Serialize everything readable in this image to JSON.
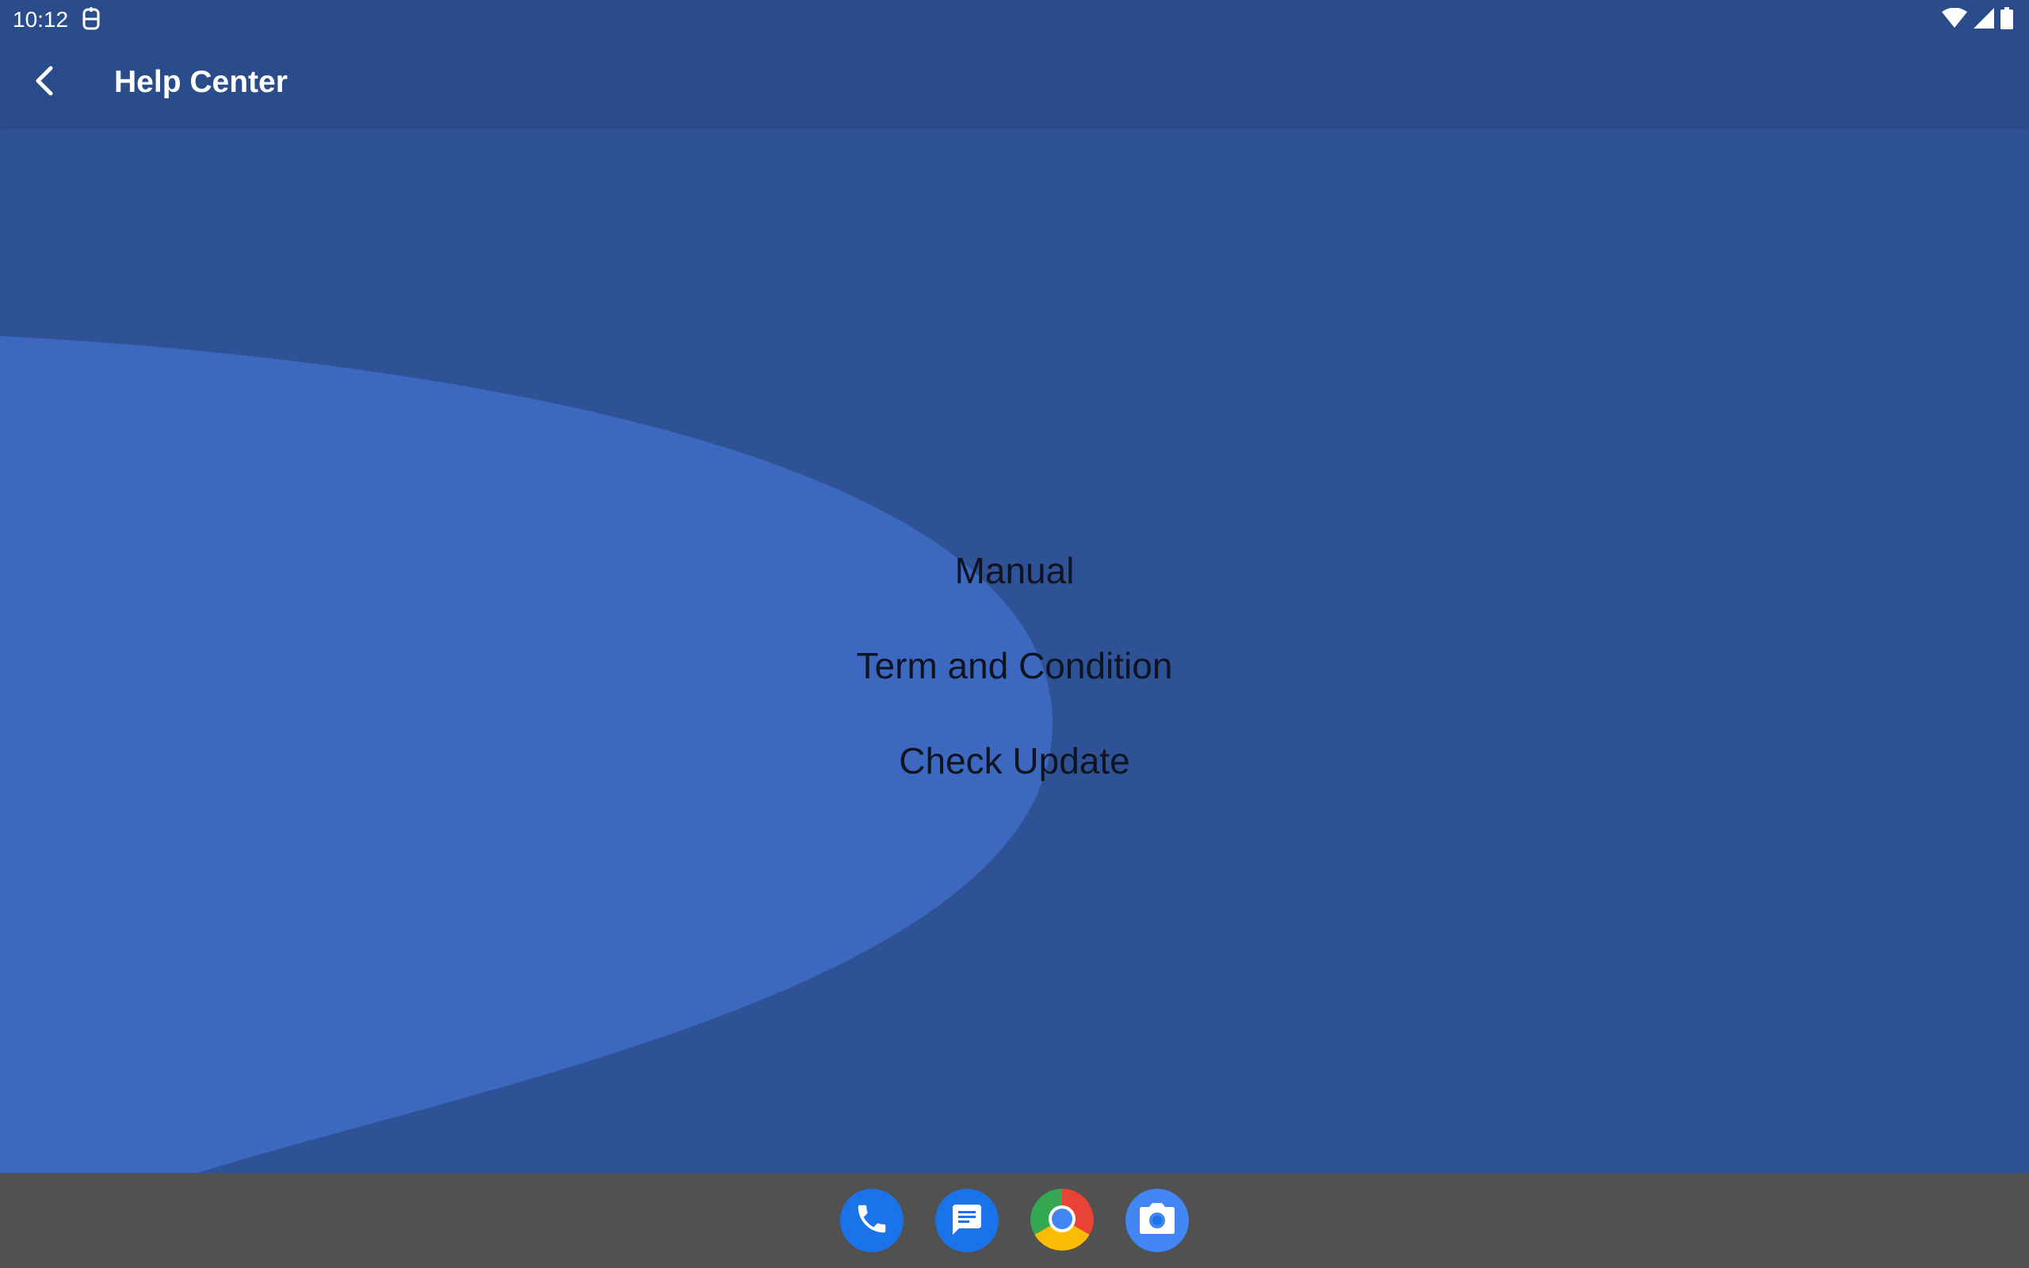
{
  "status_bar": {
    "time": "10:12",
    "notification_icon": "vpn-key-icon",
    "right_icons": [
      "wifi-icon",
      "cell-signal-icon",
      "battery-icon"
    ]
  },
  "app_bar": {
    "back_icon": "chevron-left-icon",
    "title": "Help Center"
  },
  "menu": {
    "items": [
      {
        "label": "Manual"
      },
      {
        "label": "Term and Condition"
      },
      {
        "label": "Check Update"
      }
    ]
  },
  "dock": {
    "apps": [
      {
        "name": "Phone",
        "icon": "phone-icon"
      },
      {
        "name": "Messages",
        "icon": "messages-icon"
      },
      {
        "name": "Chrome",
        "icon": "chrome-icon"
      },
      {
        "name": "Camera",
        "icon": "camera-icon"
      }
    ]
  },
  "colors": {
    "app_bar": "#2b4c8a",
    "background": "#2f5297",
    "accent_shape": "#3d68c0",
    "menu_text": "#0f1420",
    "dock": "#515151"
  }
}
